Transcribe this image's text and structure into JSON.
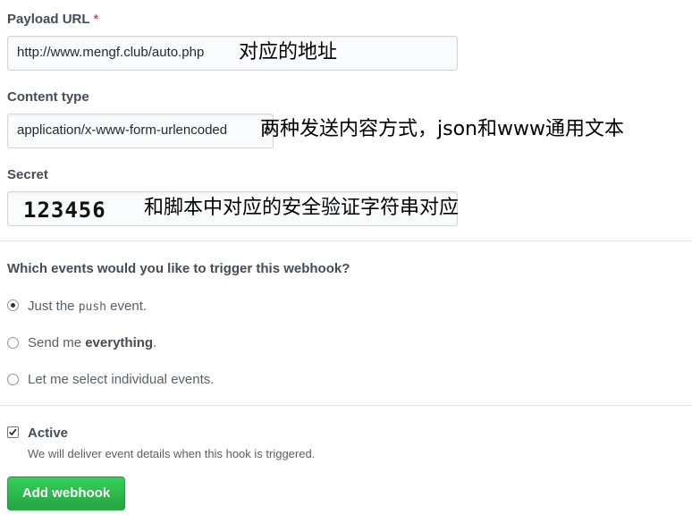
{
  "payload_url": {
    "label": "Payload URL",
    "required_mark": "*",
    "value": "http://www.mengf.club/auto.php",
    "annotation": "对应的地址"
  },
  "content_type": {
    "label": "Content type",
    "selected": "application/x-www-form-urlencoded",
    "annotation": "两种发送内容方式，json和www通用文本"
  },
  "secret": {
    "label": "Secret",
    "value": "123456",
    "annotation": "和脚本中对应的安全验证字符串对应"
  },
  "events": {
    "question": "Which events would you like to trigger this webhook?",
    "options": [
      {
        "pre": "Just the ",
        "code": "push",
        "post": " event.",
        "checked": true
      },
      {
        "pre": "Send me ",
        "strong": "everything",
        "post": ".",
        "checked": false
      },
      {
        "text": "Let me select individual events.",
        "checked": false
      }
    ]
  },
  "active": {
    "label": "Active",
    "checked": true,
    "note": "We will deliver event details when this hook is triggered."
  },
  "submit": {
    "label": "Add webhook"
  },
  "colors": {
    "button_green": "#28a745",
    "required_red": "#cb2431"
  },
  "icons": {
    "select": "select-arrows-icon",
    "check": "check-icon"
  }
}
